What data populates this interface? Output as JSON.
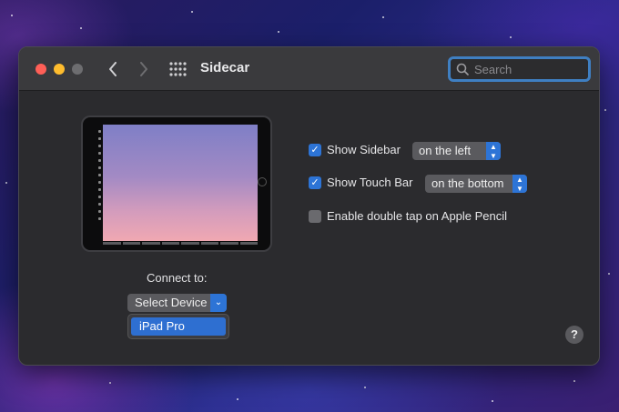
{
  "window": {
    "title": "Sidecar"
  },
  "toolbar": {
    "back_icon": "chevron-left-icon",
    "forward_icon": "chevron-right-icon",
    "grid_icon": "grid-icon",
    "search_placeholder": "Search"
  },
  "preview": {
    "connect_label": "Connect to:",
    "select_device_label": "Select Device",
    "dropdown_items": [
      "iPad Pro"
    ]
  },
  "options": {
    "show_sidebar": {
      "label": "Show Sidebar",
      "checked": true,
      "value": "on the left"
    },
    "show_touch_bar": {
      "label": "Show Touch Bar",
      "checked": true,
      "value": "on the bottom"
    },
    "double_tap": {
      "label": "Enable double tap on Apple Pencil",
      "checked": false
    }
  },
  "help": {
    "label": "?"
  },
  "colors": {
    "accent": "#2d74d6",
    "window_bg": "#2b2b2e",
    "titlebar_bg": "#3a3a3d"
  }
}
